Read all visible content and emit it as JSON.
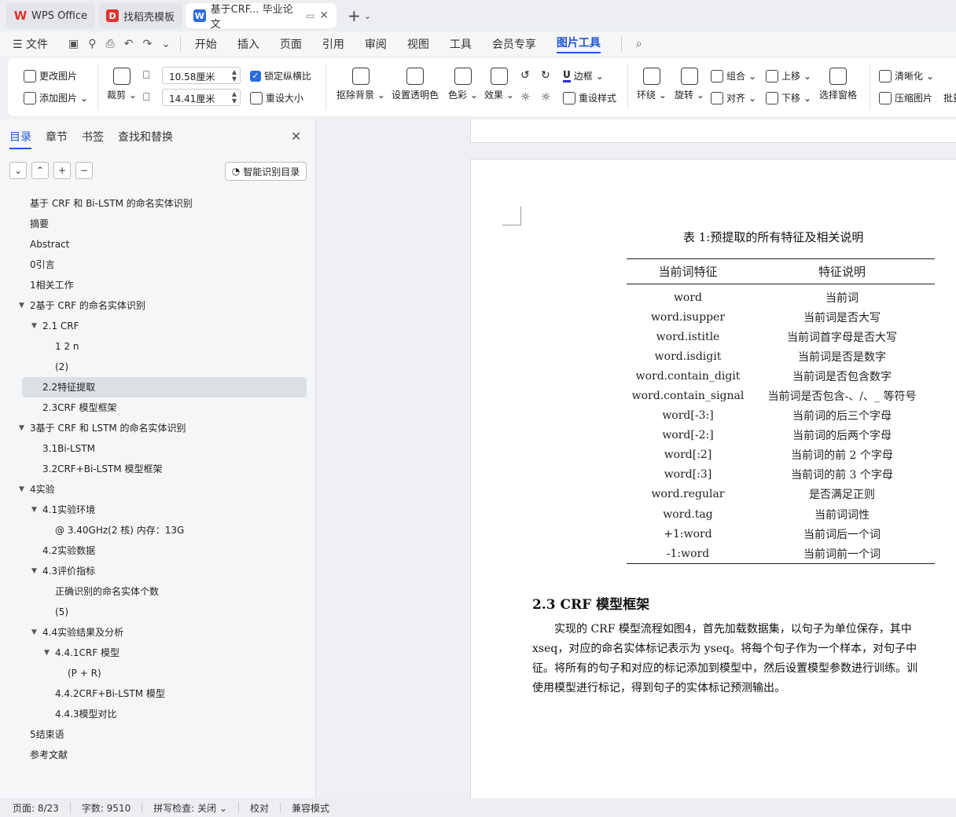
{
  "tabs": [
    {
      "label": "WPS Office",
      "icon": "wps-logo-icon"
    },
    {
      "label": "找稻壳模板",
      "icon": "daoke-logo-icon"
    },
    {
      "label": "基于CRF... 毕业论文",
      "icon": "word-doc-icon"
    }
  ],
  "menu": {
    "file": "文件",
    "items": [
      "开始",
      "插入",
      "页面",
      "引用",
      "审阅",
      "视图",
      "工具",
      "会员专享",
      "图片工具"
    ],
    "active": "图片工具"
  },
  "ribbon": {
    "change_picture": "更改图片",
    "add_picture": "添加图片",
    "crop": "裁剪",
    "width_value": "10.58厘米",
    "height_value": "14.41厘米",
    "lock_ratio": "锁定纵横比",
    "reset_size": "重设大小",
    "remove_bg": "抠除背景",
    "set_transparent": "设置透明色",
    "color": "色彩",
    "effects": "效果",
    "border": "边框",
    "reset_style": "重设样式",
    "wrap": "环绕",
    "rotate": "旋转",
    "group": "组合",
    "align": "对齐",
    "bring_up": "上移",
    "send_down": "下移",
    "select_pane": "选择窗格",
    "sharpen": "清晰化",
    "compress": "压缩图片",
    "batch": "批量"
  },
  "left_panel": {
    "tabs": [
      "目录",
      "章节",
      "书签",
      "查找和替换"
    ],
    "active_tab": "目录",
    "smart_toc": "智能识别目录",
    "toc": [
      {
        "label": "基于 CRF 和 Bi-LSTM 的命名实体识别",
        "level": 1,
        "caret": false
      },
      {
        "label": "摘要",
        "level": 1,
        "caret": false
      },
      {
        "label": "Abstract",
        "level": 1,
        "caret": false
      },
      {
        "label": "0引言",
        "level": 1,
        "caret": false
      },
      {
        "label": "1相关工作",
        "level": 1,
        "caret": false
      },
      {
        "label": "2基于 CRF 的命名实体识别",
        "level": 1,
        "caret": true
      },
      {
        "label": "2.1 CRF",
        "level": 2,
        "caret": true
      },
      {
        "label": "1 2 n",
        "level": 3,
        "caret": false
      },
      {
        "label": "(2)",
        "level": 3,
        "caret": false
      },
      {
        "label": "2.2特征提取",
        "level": 2,
        "caret": false,
        "selected": true
      },
      {
        "label": "2.3CRF 模型框架",
        "level": 2,
        "caret": false
      },
      {
        "label": "3基于 CRF 和 LSTM 的命名实体识别",
        "level": 1,
        "caret": true
      },
      {
        "label": "3.1Bi-LSTM",
        "level": 2,
        "caret": false
      },
      {
        "label": "3.2CRF+Bi-LSTM 模型框架",
        "level": 2,
        "caret": false
      },
      {
        "label": "4实验",
        "level": 1,
        "caret": true
      },
      {
        "label": "4.1实验环境",
        "level": 2,
        "caret": true
      },
      {
        "label": "@ 3.40GHz(2 核) 内存：13G",
        "level": 3,
        "caret": false
      },
      {
        "label": "4.2实验数据",
        "level": 2,
        "caret": false
      },
      {
        "label": "4.3评价指标",
        "level": 2,
        "caret": true
      },
      {
        "label": "正确识别的命名实体个数",
        "level": 3,
        "caret": false
      },
      {
        "label": "(5)",
        "level": 3,
        "caret": false
      },
      {
        "label": "4.4实验结果及分析",
        "level": 2,
        "caret": true
      },
      {
        "label": "4.4.1CRF 模型",
        "level": 3,
        "caret": true
      },
      {
        "label": "(P + R)",
        "level": 4,
        "caret": false
      },
      {
        "label": "4.4.2CRF+Bi-LSTM 模型",
        "level": 3,
        "caret": false
      },
      {
        "label": "4.4.3模型对比",
        "level": 3,
        "caret": false
      },
      {
        "label": "5结束语",
        "level": 1,
        "caret": false
      },
      {
        "label": "参考文献",
        "level": 1,
        "caret": false
      }
    ]
  },
  "document": {
    "caption": "表 1:预提取的所有特征及相关说明",
    "table": {
      "headers": [
        "当前词特征",
        "特征说明"
      ],
      "rows": [
        [
          "word",
          "当前词"
        ],
        [
          "word.isupper",
          "当前词是否大写"
        ],
        [
          "word.istitle",
          "当前词首字母是否大写"
        ],
        [
          "word.isdigit",
          "当前词是否是数字"
        ],
        [
          "word.contain_digit",
          "当前词是否包含数字"
        ],
        [
          "word.contain_signal",
          "当前词是否包含-、/、_ 等符号"
        ],
        [
          "word[-3:]",
          "当前词的后三个字母"
        ],
        [
          "word[-2:]",
          "当前词的后两个字母"
        ],
        [
          "word[:2]",
          "当前词的前 2 个字母"
        ],
        [
          "word[:3]",
          "当前词的前 3 个字母"
        ],
        [
          "word.regular",
          "是否满足正则"
        ],
        [
          "word.tag",
          "当前词词性"
        ],
        [
          "+1:word",
          "当前词后一个词"
        ],
        [
          "-1:word",
          "当前词前一个词"
        ]
      ]
    },
    "section_heading": "2.3    CRF 模型框架",
    "paragraph_lines": [
      "实现的 CRF 模型流程如图4，首先加载数据集，以句子为单位保存，其中",
      "xseq，对应的命名实体标记表示为 yseq。将每个句子作为一个样本，对句子中",
      "征。将所有的句子和对应的标记添加到模型中，然后设置模型参数进行训练。训",
      "使用模型进行标记，得到句子的实体标记预测输出。"
    ]
  },
  "status": {
    "page": "页面: 8/23",
    "words": "字数: 9510",
    "spellcheck": "拼写检查: 关闭",
    "proofread": "校对",
    "compat": "兼容模式"
  }
}
